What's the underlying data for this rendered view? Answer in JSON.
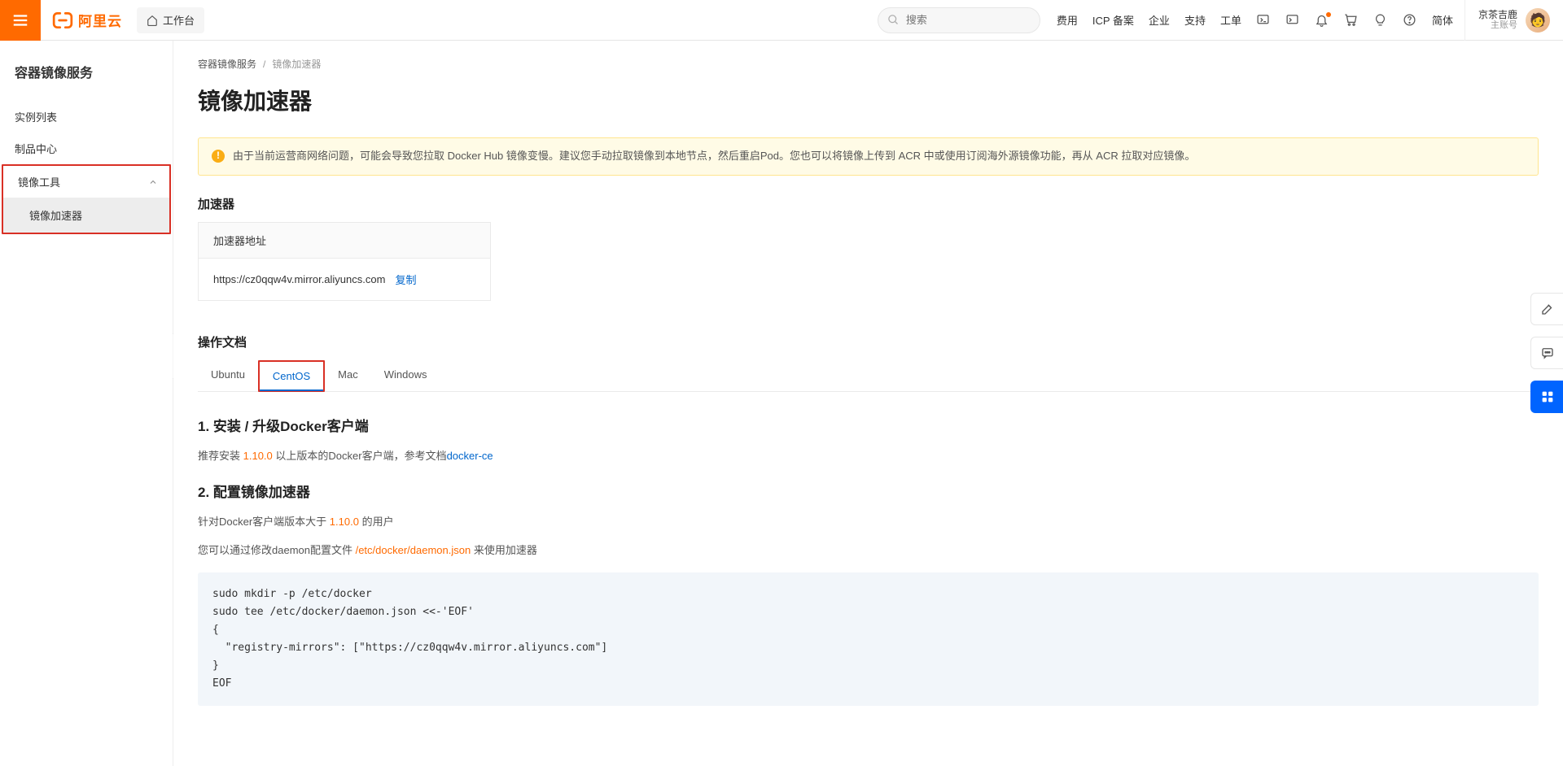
{
  "brand": {
    "name": "阿里云"
  },
  "topbar": {
    "workbench": "工作台",
    "search_placeholder": "搜索",
    "links": {
      "fee": "费用",
      "icp": "ICP 备案",
      "enterprise": "企业",
      "support": "支持",
      "ticket": "工单",
      "lang": "简体"
    },
    "account": {
      "name": "京茶吉鹿",
      "role": "主账号"
    }
  },
  "sidebar": {
    "title": "容器镜像服务",
    "instance_list": "实例列表",
    "product_center": "制品中心",
    "tools_group": "镜像工具",
    "mirror_accel": "镜像加速器"
  },
  "breadcrumb": {
    "root": "容器镜像服务",
    "current": "镜像加速器"
  },
  "page": {
    "title": "镜像加速器",
    "alert": "由于当前运营商网络问题，可能会导致您拉取 Docker Hub 镜像变慢。建议您手动拉取镜像到本地节点，然后重启Pod。您也可以将镜像上传到 ACR 中或使用订阅海外源镜像功能，再从 ACR 拉取对应镜像。",
    "accel_section": "加速器",
    "addr_label": "加速器地址",
    "addr_value": "https://cz0qqw4v.mirror.aliyuncs.com",
    "copy": "复制",
    "doc_section": "操作文档",
    "tabs": {
      "ubuntu": "Ubuntu",
      "centos": "CentOS",
      "mac": "Mac",
      "windows": "Windows"
    },
    "doc": {
      "h1": "1. 安装 / 升级Docker客户端",
      "p1a": "推荐安装 ",
      "p1ver": "1.10.0",
      "p1b": " 以上版本的Docker客户端，参考文档",
      "p1link": "docker-ce",
      "h2": "2. 配置镜像加速器",
      "p2a": "针对Docker客户端版本大于 ",
      "p2ver": "1.10.0",
      "p2b": " 的用户",
      "p3a": "您可以通过修改daemon配置文件 ",
      "p3path": "/etc/docker/daemon.json",
      "p3b": " 来使用加速器",
      "code": "sudo mkdir -p /etc/docker\nsudo tee /etc/docker/daemon.json <<-'EOF'\n{\n  \"registry-mirrors\": [\"https://cz0qqw4v.mirror.aliyuncs.com\"]\n}\nEOF"
    }
  }
}
